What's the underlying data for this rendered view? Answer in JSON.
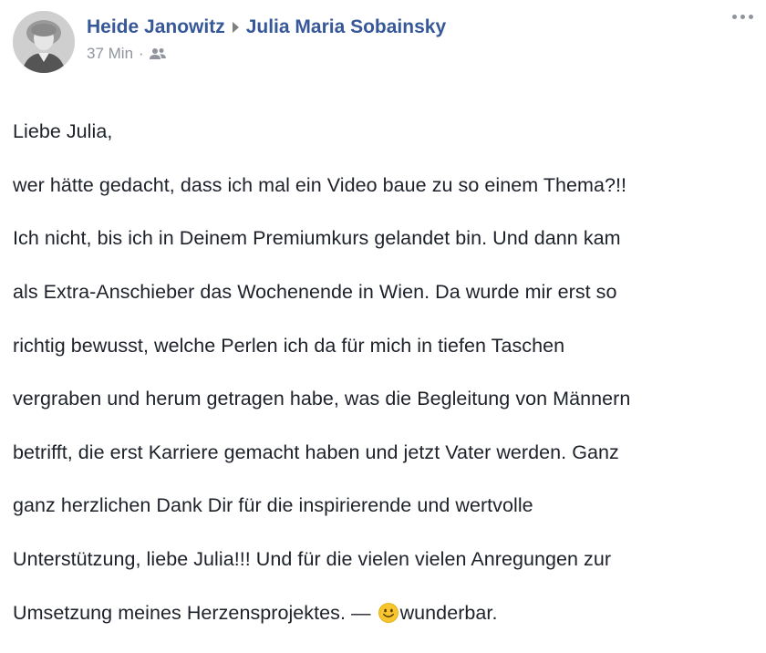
{
  "post": {
    "author": "Heide Janowitz",
    "recipient": "Julia Maria Sobainsky",
    "time": "37 Min",
    "separator": "·",
    "audience_icon": "friends-icon",
    "lines": [
      "Liebe Julia,",
      "wer hätte gedacht, dass ich mal ein Video baue zu so einem Thema?!!",
      "Ich nicht, bis ich in Deinem Premiumkurs gelandet bin. Und dann kam",
      "als Extra-Anschieber das Wochenende in Wien. Da wurde mir erst so",
      "richtig bewusst, welche Perlen ich da für mich in tiefen Taschen",
      "vergraben und herum getragen habe, was die Begleitung von Männern",
      "betrifft, die erst Karriere gemacht haben und jetzt Vater werden. Ganz",
      "ganz herzlichen Dank Dir für die inspirierende und wertvolle",
      "Unterstützung, liebe Julia!!! Und für die vielen vielen Anregungen zur"
    ],
    "last_line_text": "Umsetzung meines Herzensprojektes.",
    "feeling_dash": "—",
    "feeling_icon": "smiley-emoji-icon",
    "feeling": "wunderbar."
  },
  "colors": {
    "link": "#365899",
    "meta": "#90949c",
    "text": "#1d2129",
    "emoji": "#f7c530"
  }
}
